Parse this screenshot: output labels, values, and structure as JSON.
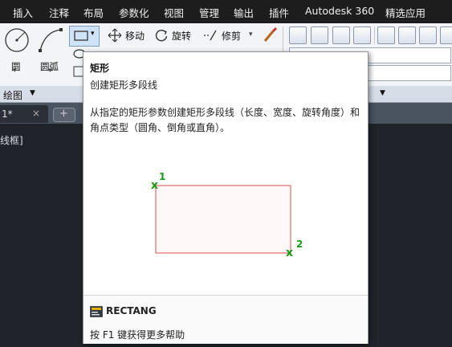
{
  "menu": {
    "items": [
      "插入",
      "注释",
      "布局",
      "参数化",
      "视图",
      "管理",
      "输出",
      "插件",
      "Autodesk 360",
      "精选应用"
    ]
  },
  "ribbon": {
    "circle_label": "圆",
    "arc_label": "圆弧",
    "move_label": "移动",
    "rotate_label": "旋转",
    "trim_label": "修剪",
    "draw_panel_label": "绘图",
    "dropdown_arrow": "▾",
    "panel_arrow": "▼"
  },
  "tabs": {
    "drawing_tab": "1*",
    "close_glyph": "×"
  },
  "workspace": {
    "viewport_label": "线框]"
  },
  "tooltip": {
    "title": "矩形",
    "subtitle": "创建矩形多段线",
    "description": "从指定的矩形参数创建矩形多段线（长度、宽度、旋转角度）和角点类型（圆角、倒角或直角）。",
    "point1": "1",
    "point2": "2",
    "marker": "x",
    "command": "RECTANG",
    "help": "按 F1 键获得更多帮助"
  },
  "colors": {
    "menubar": "#1d1d1d",
    "rect_stroke": "#e36b6b",
    "marker_green": "#1a9a12"
  }
}
